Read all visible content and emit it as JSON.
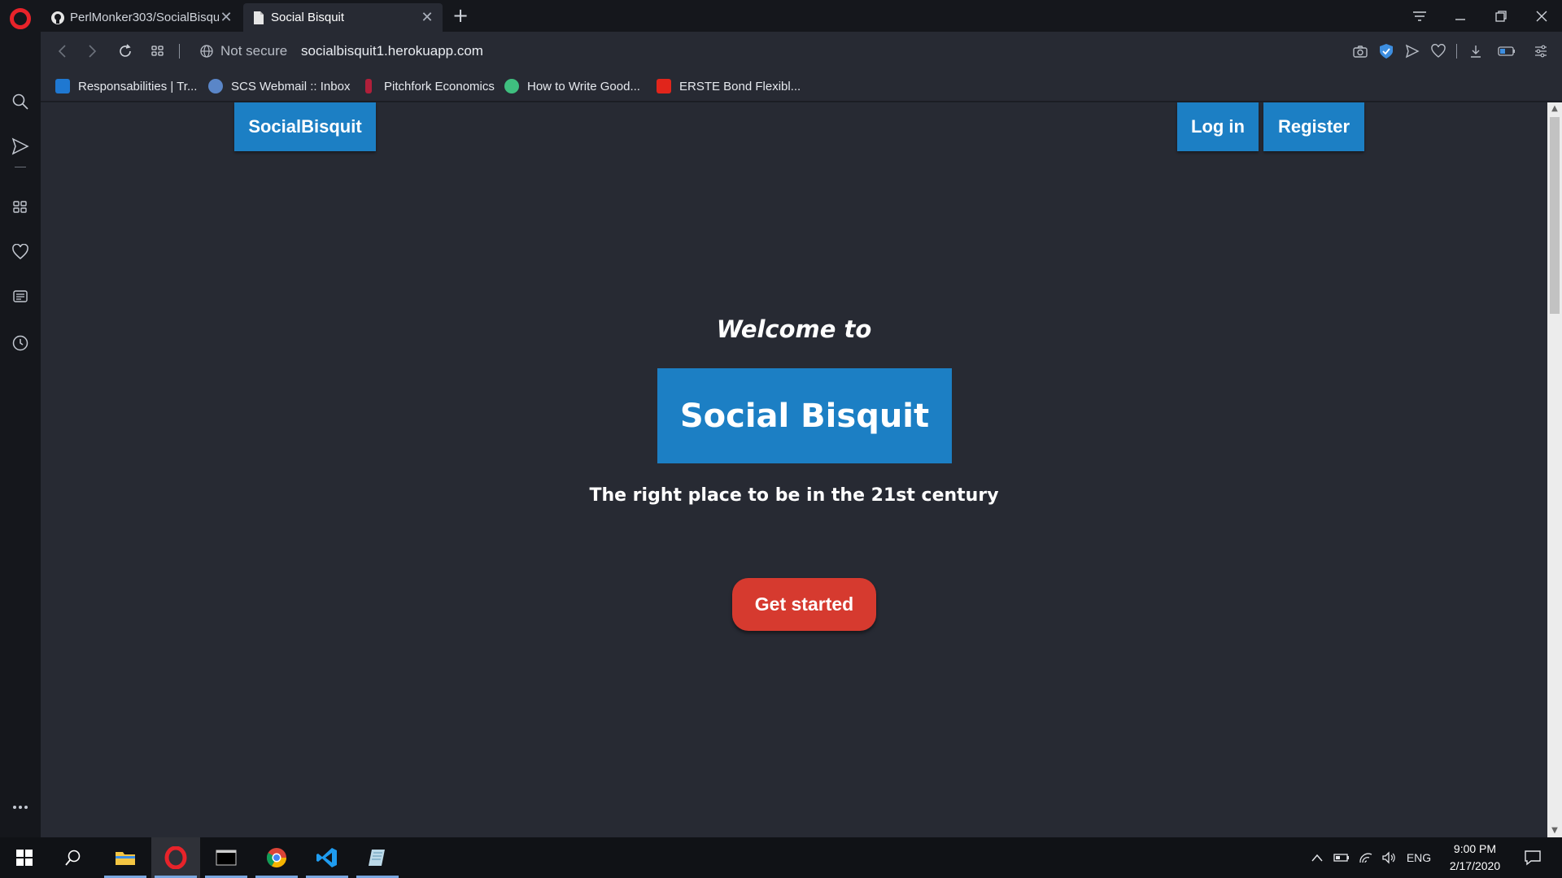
{
  "browser": {
    "tabs": [
      {
        "title": "PerlMonker303/SocialBisquit",
        "close": "✕"
      },
      {
        "title": "Social Bisquit",
        "close": "✕"
      }
    ],
    "new_tab": "+",
    "security_label": "Not secure",
    "url": "socialbisquit1.herokuapp.com",
    "bookmarks": [
      {
        "label": "Responsabilities | Tr...",
        "color": "#1f78d1"
      },
      {
        "label": "SCS Webmail :: Inbox",
        "color": "#5a86c8"
      },
      {
        "label": "Pitchfork Economics",
        "color": "#b01f3a"
      },
      {
        "label": "How to Write Good...",
        "color": "#3fbf7f"
      },
      {
        "label": "ERSTE Bond Flexibl...",
        "color": "#e1251b"
      }
    ]
  },
  "page": {
    "brand": "SocialBisquit",
    "login": "Log in",
    "register": "Register",
    "welcome": "Welcome to",
    "hero_title": "Social Bisquit",
    "tagline": "The right place to be in the 21st century",
    "cta": "Get started",
    "colors": {
      "primary": "#1c7fc4",
      "cta": "#d63a2f",
      "background": "#272a33"
    }
  },
  "taskbar": {
    "language": "ENG",
    "time": "9:00 PM",
    "date": "2/17/2020"
  }
}
